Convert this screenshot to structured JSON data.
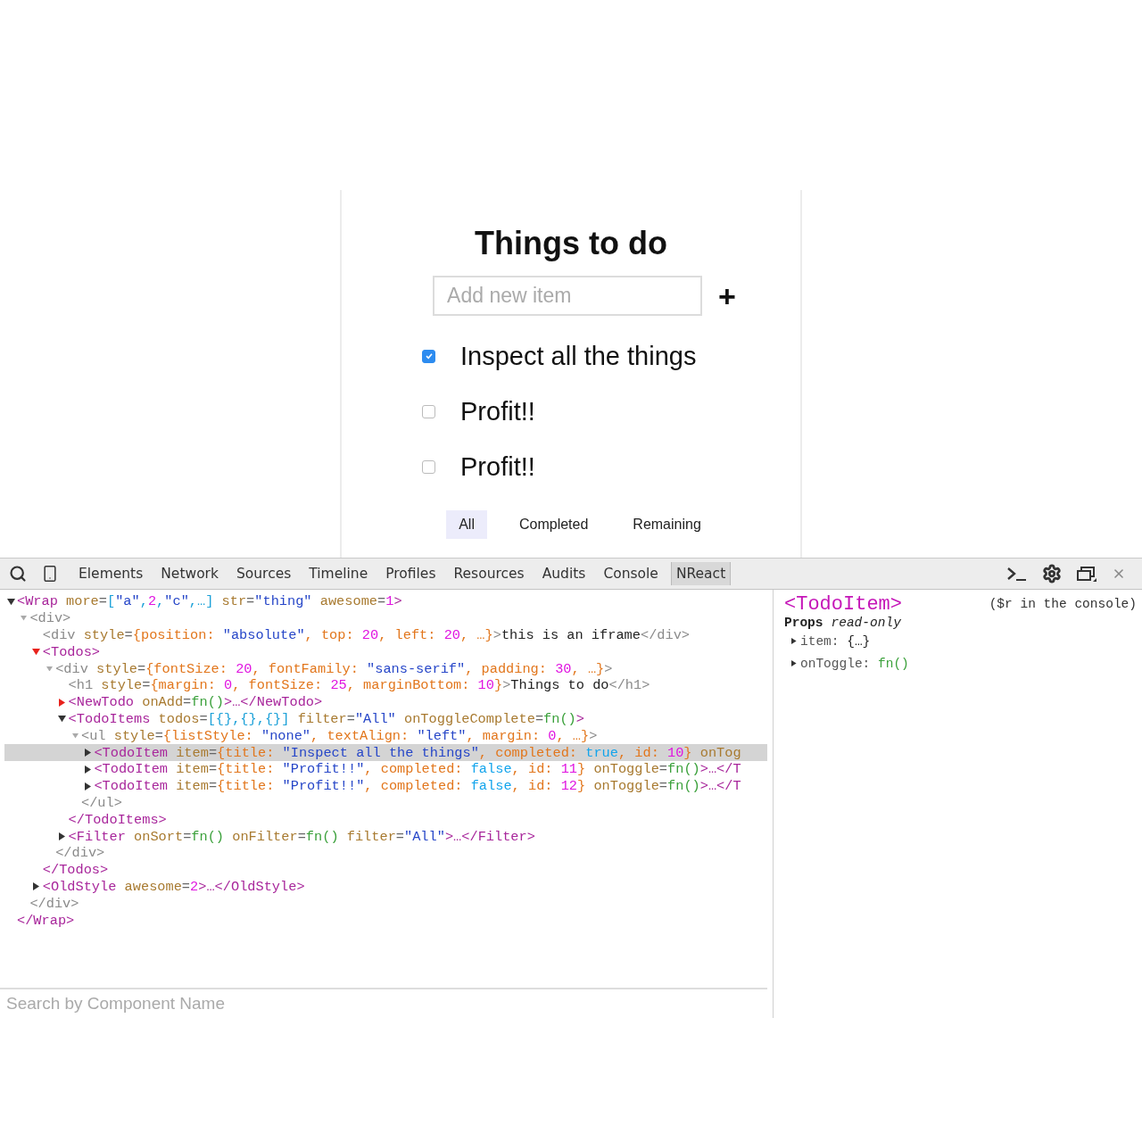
{
  "app": {
    "title": "Things to do",
    "input": {
      "placeholder": "Add new item"
    },
    "add_button": "+",
    "items": [
      {
        "title": "Inspect all the things",
        "completed": true
      },
      {
        "title": "Profit!!",
        "completed": false
      },
      {
        "title": "Profit!!",
        "completed": false
      }
    ],
    "filters": [
      {
        "label": "All",
        "selected": true
      },
      {
        "label": "Completed",
        "selected": false
      },
      {
        "label": "Remaining",
        "selected": false
      }
    ]
  },
  "devtools": {
    "tabs": [
      {
        "label": "Elements",
        "selected": false
      },
      {
        "label": "Network",
        "selected": false
      },
      {
        "label": "Sources",
        "selected": false
      },
      {
        "label": "Timeline",
        "selected": false
      },
      {
        "label": "Profiles",
        "selected": false
      },
      {
        "label": "Resources",
        "selected": false
      },
      {
        "label": "Audits",
        "selected": false
      },
      {
        "label": "Console",
        "selected": false
      },
      {
        "label": "NReact",
        "selected": true
      }
    ],
    "tree": [
      {
        "kind": "component",
        "expandable": true,
        "expanded": true,
        "flagged": false,
        "selected": false,
        "open": [
          {
            "kind": "tag",
            "t": "<Wrap"
          },
          {
            "kind": "attr",
            "t": " more"
          },
          {
            "kind": "eq",
            "t": "="
          },
          {
            "kind": "arr",
            "t": "["
          },
          {
            "kind": "str",
            "t": "\"a\""
          },
          {
            "kind": "arr",
            "t": ","
          },
          {
            "kind": "num",
            "t": "2"
          },
          {
            "kind": "arr",
            "t": ","
          },
          {
            "kind": "str",
            "t": "\"c\""
          },
          {
            "kind": "arr",
            "t": ",…]"
          },
          {
            "kind": "attr",
            "t": " str"
          },
          {
            "kind": "eq",
            "t": "="
          },
          {
            "kind": "str",
            "t": "\"thing\""
          },
          {
            "kind": "attr",
            "t": " awesome"
          },
          {
            "kind": "eq",
            "t": "="
          },
          {
            "kind": "num",
            "t": "1"
          },
          {
            "kind": "tag",
            "t": ">"
          }
        ],
        "close": [
          {
            "kind": "tag",
            "t": "</Wrap>"
          }
        ],
        "children": [
          {
            "kind": "dom",
            "expandable": true,
            "expanded": true,
            "flagged": false,
            "selected": false,
            "open": [
              {
                "kind": "dom",
                "t": "<div>"
              }
            ],
            "close": [
              {
                "kind": "dom",
                "t": "</div>"
              }
            ],
            "children": [
              {
                "expandable": false,
                "selected": false,
                "open": [
                  {
                    "kind": "dom",
                    "t": "<div"
                  },
                  {
                    "kind": "attr",
                    "t": " style"
                  },
                  {
                    "kind": "eq",
                    "t": "="
                  },
                  {
                    "kind": "obj",
                    "t": "{position: "
                  },
                  {
                    "kind": "str",
                    "t": "\"absolute\""
                  },
                  {
                    "kind": "obj",
                    "t": ", top: "
                  },
                  {
                    "kind": "num",
                    "t": "20"
                  },
                  {
                    "kind": "obj",
                    "t": ", left: "
                  },
                  {
                    "kind": "num",
                    "t": "20"
                  },
                  {
                    "kind": "obj",
                    "t": ", …}"
                  },
                  {
                    "kind": "dom",
                    "t": ">"
                  },
                  {
                    "kind": "text",
                    "t": "this is an iframe"
                  },
                  {
                    "kind": "dom",
                    "t": "</div>"
                  }
                ]
              },
              {
                "kind": "component",
                "expandable": true,
                "expanded": true,
                "flagged": true,
                "selected": false,
                "open": [
                  {
                    "kind": "tag",
                    "t": "<Todos>"
                  }
                ],
                "close": [
                  {
                    "kind": "tag",
                    "t": "</Todos>"
                  }
                ],
                "children": [
                  {
                    "kind": "dom",
                    "expandable": true,
                    "expanded": true,
                    "flagged": false,
                    "selected": false,
                    "open": [
                      {
                        "kind": "dom",
                        "t": "<div"
                      },
                      {
                        "kind": "attr",
                        "t": " style"
                      },
                      {
                        "kind": "eq",
                        "t": "="
                      },
                      {
                        "kind": "obj",
                        "t": "{fontSize: "
                      },
                      {
                        "kind": "num",
                        "t": "20"
                      },
                      {
                        "kind": "obj",
                        "t": ", fontFamily: "
                      },
                      {
                        "kind": "str",
                        "t": "\"sans-serif\""
                      },
                      {
                        "kind": "obj",
                        "t": ", padding: "
                      },
                      {
                        "kind": "num",
                        "t": "30"
                      },
                      {
                        "kind": "obj",
                        "t": ", …}"
                      },
                      {
                        "kind": "dom",
                        "t": ">"
                      }
                    ],
                    "close": [
                      {
                        "kind": "dom",
                        "t": "</div>"
                      }
                    ],
                    "children": [
                      {
                        "expandable": false,
                        "selected": false,
                        "open": [
                          {
                            "kind": "dom",
                            "t": "<h1"
                          },
                          {
                            "kind": "attr",
                            "t": " style"
                          },
                          {
                            "kind": "eq",
                            "t": "="
                          },
                          {
                            "kind": "obj",
                            "t": "{margin: "
                          },
                          {
                            "kind": "num",
                            "t": "0"
                          },
                          {
                            "kind": "obj",
                            "t": ", fontSize: "
                          },
                          {
                            "kind": "num",
                            "t": "25"
                          },
                          {
                            "kind": "obj",
                            "t": ", marginBottom: "
                          },
                          {
                            "kind": "num",
                            "t": "10"
                          },
                          {
                            "kind": "obj",
                            "t": "}"
                          },
                          {
                            "kind": "dom",
                            "t": ">"
                          },
                          {
                            "kind": "text",
                            "t": "Things to do"
                          },
                          {
                            "kind": "dom",
                            "t": "</h1>"
                          }
                        ]
                      },
                      {
                        "kind": "component",
                        "expandable": true,
                        "expanded": false,
                        "flagged": true,
                        "selected": false,
                        "open": [
                          {
                            "kind": "tag",
                            "t": "<NewTodo"
                          },
                          {
                            "kind": "attr",
                            "t": " onAdd"
                          },
                          {
                            "kind": "eq",
                            "t": "="
                          },
                          {
                            "kind": "fn",
                            "t": "fn()"
                          },
                          {
                            "kind": "tag",
                            "t": ">…</NewTodo>"
                          }
                        ]
                      },
                      {
                        "kind": "component",
                        "expandable": true,
                        "expanded": true,
                        "flagged": false,
                        "selected": false,
                        "open": [
                          {
                            "kind": "tag",
                            "t": "<TodoItems"
                          },
                          {
                            "kind": "attr",
                            "t": " todos"
                          },
                          {
                            "kind": "eq",
                            "t": "="
                          },
                          {
                            "kind": "arr",
                            "t": "[{},{},{}]"
                          },
                          {
                            "kind": "attr",
                            "t": " filter"
                          },
                          {
                            "kind": "eq",
                            "t": "="
                          },
                          {
                            "kind": "str",
                            "t": "\"All\""
                          },
                          {
                            "kind": "attr",
                            "t": " onToggleComplete"
                          },
                          {
                            "kind": "eq",
                            "t": "="
                          },
                          {
                            "kind": "fn",
                            "t": "fn()"
                          },
                          {
                            "kind": "tag",
                            "t": ">"
                          }
                        ],
                        "close": [
                          {
                            "kind": "tag",
                            "t": "</TodoItems>"
                          }
                        ],
                        "children": [
                          {
                            "kind": "dom",
                            "expandable": true,
                            "expanded": true,
                            "flagged": false,
                            "selected": false,
                            "open": [
                              {
                                "kind": "dom",
                                "t": "<ul"
                              },
                              {
                                "kind": "attr",
                                "t": " style"
                              },
                              {
                                "kind": "eq",
                                "t": "="
                              },
                              {
                                "kind": "obj",
                                "t": "{listStyle: "
                              },
                              {
                                "kind": "str",
                                "t": "\"none\""
                              },
                              {
                                "kind": "obj",
                                "t": ", textAlign: "
                              },
                              {
                                "kind": "str",
                                "t": "\"left\""
                              },
                              {
                                "kind": "obj",
                                "t": ", margin: "
                              },
                              {
                                "kind": "num",
                                "t": "0"
                              },
                              {
                                "kind": "obj",
                                "t": ", …}"
                              },
                              {
                                "kind": "dom",
                                "t": ">"
                              }
                            ],
                            "close": [
                              {
                                "kind": "dom",
                                "t": "</ul>"
                              }
                            ],
                            "children": [
                              {
                                "kind": "component",
                                "expandable": true,
                                "expanded": false,
                                "flagged": false,
                                "selected": true,
                                "open": [
                                  {
                                    "kind": "tag",
                                    "t": "<TodoItem"
                                  },
                                  {
                                    "kind": "attr",
                                    "t": " item"
                                  },
                                  {
                                    "kind": "eq",
                                    "t": "="
                                  },
                                  {
                                    "kind": "obj",
                                    "t": "{title: "
                                  },
                                  {
                                    "kind": "str",
                                    "t": "\"Inspect all the things\""
                                  },
                                  {
                                    "kind": "obj",
                                    "t": ", completed: "
                                  },
                                  {
                                    "kind": "bool",
                                    "t": "true"
                                  },
                                  {
                                    "kind": "obj",
                                    "t": ", id: "
                                  },
                                  {
                                    "kind": "num",
                                    "t": "10"
                                  },
                                  {
                                    "kind": "obj",
                                    "t": "}"
                                  },
                                  {
                                    "kind": "attr",
                                    "t": " onTog"
                                  }
                                ]
                              },
                              {
                                "kind": "component",
                                "expandable": true,
                                "expanded": false,
                                "flagged": false,
                                "selected": false,
                                "open": [
                                  {
                                    "kind": "tag",
                                    "t": "<TodoItem"
                                  },
                                  {
                                    "kind": "attr",
                                    "t": " item"
                                  },
                                  {
                                    "kind": "eq",
                                    "t": "="
                                  },
                                  {
                                    "kind": "obj",
                                    "t": "{title: "
                                  },
                                  {
                                    "kind": "str",
                                    "t": "\"Profit!!\""
                                  },
                                  {
                                    "kind": "obj",
                                    "t": ", completed: "
                                  },
                                  {
                                    "kind": "bool",
                                    "t": "false"
                                  },
                                  {
                                    "kind": "obj",
                                    "t": ", id: "
                                  },
                                  {
                                    "kind": "num",
                                    "t": "11"
                                  },
                                  {
                                    "kind": "obj",
                                    "t": "}"
                                  },
                                  {
                                    "kind": "attr",
                                    "t": " onToggle"
                                  },
                                  {
                                    "kind": "eq",
                                    "t": "="
                                  },
                                  {
                                    "kind": "fn",
                                    "t": "fn()"
                                  },
                                  {
                                    "kind": "tag",
                                    "t": ">…</T"
                                  }
                                ]
                              },
                              {
                                "kind": "component",
                                "expandable": true,
                                "expanded": false,
                                "flagged": false,
                                "selected": false,
                                "open": [
                                  {
                                    "kind": "tag",
                                    "t": "<TodoItem"
                                  },
                                  {
                                    "kind": "attr",
                                    "t": " item"
                                  },
                                  {
                                    "kind": "eq",
                                    "t": "="
                                  },
                                  {
                                    "kind": "obj",
                                    "t": "{title: "
                                  },
                                  {
                                    "kind": "str",
                                    "t": "\"Profit!!\""
                                  },
                                  {
                                    "kind": "obj",
                                    "t": ", completed: "
                                  },
                                  {
                                    "kind": "bool",
                                    "t": "false"
                                  },
                                  {
                                    "kind": "obj",
                                    "t": ", id: "
                                  },
                                  {
                                    "kind": "num",
                                    "t": "12"
                                  },
                                  {
                                    "kind": "obj",
                                    "t": "}"
                                  },
                                  {
                                    "kind": "attr",
                                    "t": " onToggle"
                                  },
                                  {
                                    "kind": "eq",
                                    "t": "="
                                  },
                                  {
                                    "kind": "fn",
                                    "t": "fn()"
                                  },
                                  {
                                    "kind": "tag",
                                    "t": ">…</T"
                                  }
                                ]
                              }
                            ]
                          }
                        ]
                      },
                      {
                        "kind": "component",
                        "expandable": true,
                        "expanded": false,
                        "flagged": false,
                        "selected": false,
                        "open": [
                          {
                            "kind": "tag",
                            "t": "<Filter"
                          },
                          {
                            "kind": "attr",
                            "t": " onSort"
                          },
                          {
                            "kind": "eq",
                            "t": "="
                          },
                          {
                            "kind": "fn",
                            "t": "fn()"
                          },
                          {
                            "kind": "attr",
                            "t": " onFilter"
                          },
                          {
                            "kind": "eq",
                            "t": "="
                          },
                          {
                            "kind": "fn",
                            "t": "fn()"
                          },
                          {
                            "kind": "attr",
                            "t": " filter"
                          },
                          {
                            "kind": "eq",
                            "t": "="
                          },
                          {
                            "kind": "str",
                            "t": "\"All\""
                          },
                          {
                            "kind": "tag",
                            "t": ">…</Filter>"
                          }
                        ]
                      }
                    ]
                  }
                ]
              },
              {
                "kind": "component",
                "expandable": true,
                "expanded": false,
                "flagged": false,
                "selected": false,
                "open": [
                  {
                    "kind": "tag",
                    "t": "<OldStyle"
                  },
                  {
                    "kind": "attr",
                    "t": " awesome"
                  },
                  {
                    "kind": "eq",
                    "t": "="
                  },
                  {
                    "kind": "num",
                    "t": "2"
                  },
                  {
                    "kind": "tag",
                    "t": ">…</OldStyle>"
                  }
                ]
              }
            ]
          }
        ]
      }
    ],
    "search": {
      "placeholder": "Search by Component Name"
    },
    "details": {
      "title": "<TodoItem>",
      "hint": "($r in the console)",
      "props_label": "Props",
      "props_note": "read-only",
      "props": [
        [
          {
            "kind": "key",
            "t": "item: "
          },
          {
            "kind": "text",
            "t": "{…}"
          }
        ],
        [
          {
            "kind": "key",
            "t": "onToggle: "
          },
          {
            "kind": "fn",
            "t": "fn()"
          }
        ]
      ]
    }
  }
}
